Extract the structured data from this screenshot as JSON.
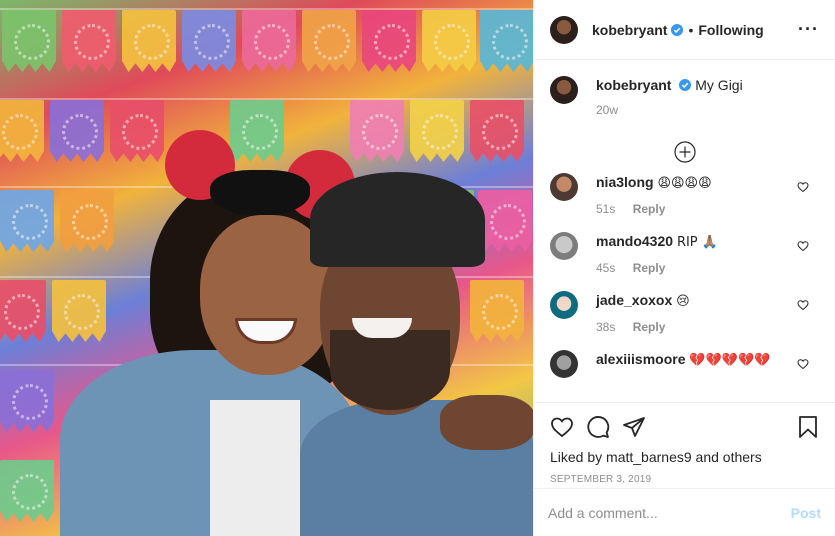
{
  "header": {
    "username": "kobebryant",
    "follow_state": "Following",
    "separator": "•",
    "more_icon": "more-horizontal-icon"
  },
  "caption": {
    "username": "kobebryant",
    "text": "My Gigi",
    "time": "20w"
  },
  "load_more_icon": "plus-circle-icon",
  "comments": [
    {
      "username": "nia3long",
      "text": "😩😩😩😩",
      "time": "51s",
      "reply": "Reply"
    },
    {
      "username": "mando4320",
      "text": "RIP 🙏🏽",
      "time": "45s",
      "reply": "Reply"
    },
    {
      "username": "jade_xoxox",
      "text": "😢",
      "time": "38s",
      "reply": "Reply"
    },
    {
      "username": "alexiiismoore",
      "text": "💔💔💔💔💔",
      "time": "",
      "reply": ""
    }
  ],
  "actions": {
    "like_icon": "heart-icon",
    "comment_icon": "comment-icon",
    "share_icon": "share-icon",
    "save_icon": "bookmark-icon"
  },
  "likes": {
    "prefix": "Liked by",
    "user": "matt_barnes9",
    "suffix": "and others"
  },
  "date": "SEPTEMBER 3, 2019",
  "add_comment": {
    "placeholder": "Add a comment...",
    "post_label": "Post"
  },
  "colors": {
    "verified": "#3897f0",
    "post_disabled": "#b3dbff",
    "secondary_text": "#8e8e8e"
  }
}
